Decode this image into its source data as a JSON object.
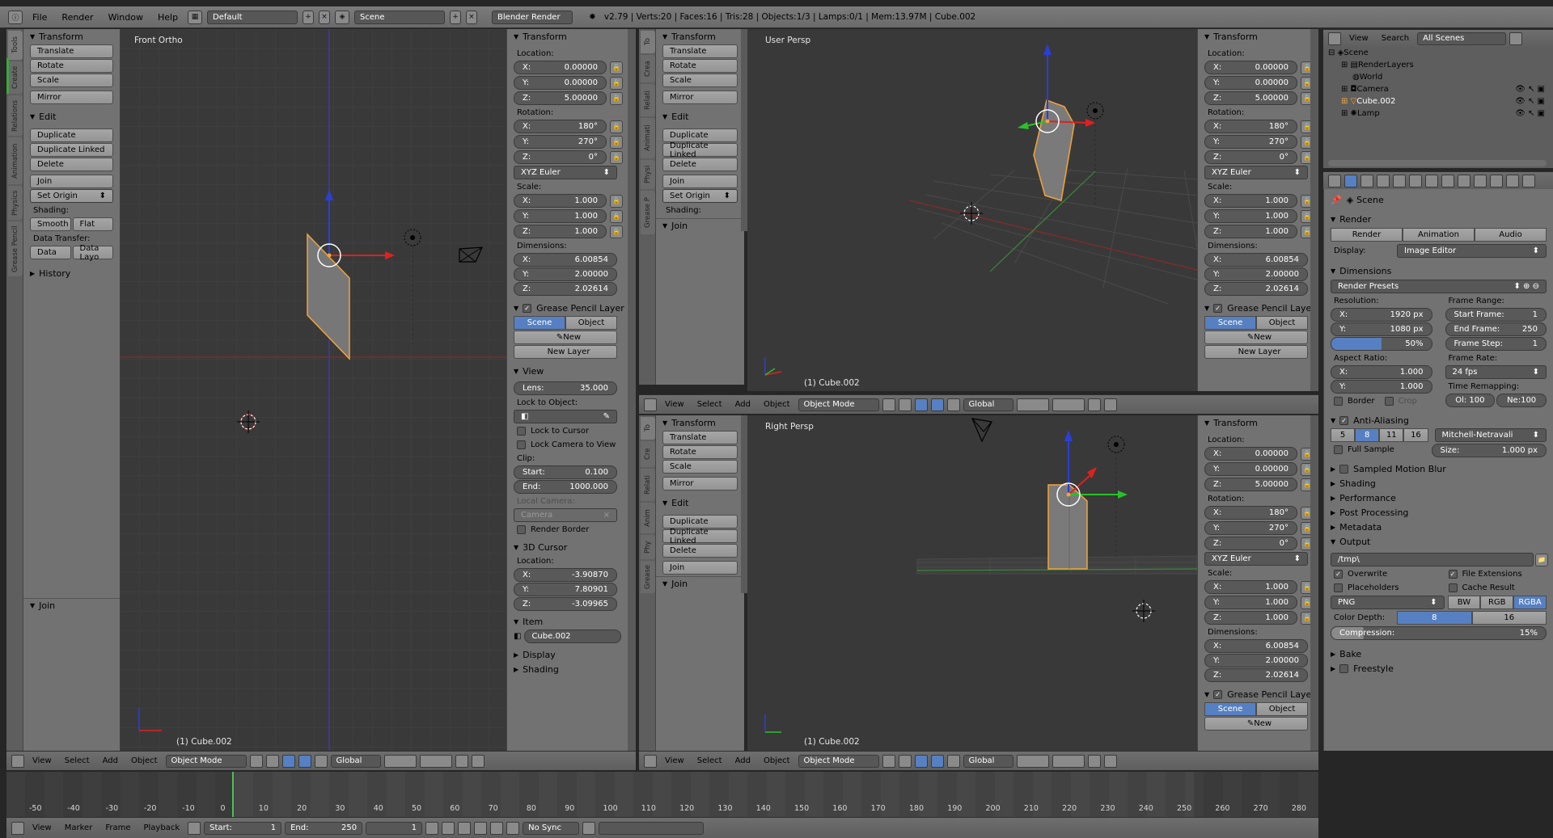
{
  "menubar": {
    "items": [
      "File",
      "Render",
      "Window",
      "Help"
    ],
    "layout": "Default",
    "scene": "Scene",
    "engine": "Blender Render",
    "stats": "v2.79 | Verts:20 | Faces:16 | Tris:28 | Objects:1/3 | Lamps:0/1 | Mem:13.97M | Cube.002"
  },
  "viewports": {
    "front": {
      "label": "Front Ortho",
      "object": "(1) Cube.002"
    },
    "user": {
      "label": "User Persp",
      "object": "(1) Cube.002"
    },
    "right": {
      "label": "Right Persp",
      "object": "(1) Cube.002"
    }
  },
  "tools": {
    "tabs": [
      "Tools",
      "Create",
      "Relations",
      "Animation",
      "Physics",
      "Grease Pencil"
    ],
    "tabs_short": [
      "To",
      "Crea",
      "Relati",
      "Animati",
      "Physi",
      "Grease P"
    ],
    "tabs_short2": [
      "To",
      "Cre",
      "Relati",
      "Anim",
      "Phy",
      "Grease"
    ],
    "transform_header": "Transform",
    "translate": "Translate",
    "rotate": "Rotate",
    "scale": "Scale",
    "mirror": "Mirror",
    "edit_header": "Edit",
    "duplicate": "Duplicate",
    "duplicate_linked": "Duplicate Linked",
    "delete": "Delete",
    "join": "Join",
    "set_origin": "Set Origin",
    "shading_label": "Shading:",
    "smooth": "Smooth",
    "flat": "Flat",
    "data_transfer_label": "Data Transfer:",
    "data": "Data",
    "data_layout": "Data Layo",
    "history": "History",
    "join_header": "Join"
  },
  "nprops": {
    "transform_header": "Transform",
    "location_label": "Location:",
    "loc": [
      "X:",
      "0.00000",
      "Y:",
      "0.00000",
      "Z:",
      "5.00000"
    ],
    "rotation_label": "Rotation:",
    "rot": [
      "X:",
      "180°",
      "Y:",
      "270°",
      "Z:",
      "0°"
    ],
    "rotation_mode": "XYZ Euler",
    "scale_label": "Scale:",
    "scl": [
      "X:",
      "1.000",
      "Y:",
      "1.000",
      "Z:",
      "1.000"
    ],
    "dimensions_label": "Dimensions:",
    "dim": [
      "X:",
      "6.00854",
      "Y:",
      "2.00000",
      "Z:",
      "2.02614"
    ],
    "grease_header": "Grease Pencil Layer",
    "scene": "Scene",
    "object": "Object",
    "new": "New",
    "new_layer": "New Layer",
    "view_header": "View",
    "lens_label": "Lens:",
    "lens": "35.000",
    "lock_object": "Lock to Object:",
    "lock_cursor": "Lock to Cursor",
    "lock_camera": "Lock Camera to View",
    "clip_label": "Clip:",
    "start_label": "Start:",
    "start": "0.100",
    "end_label": "End:",
    "end": "1000.000",
    "local_camera": "Local Camera:",
    "camera": "Camera",
    "render_border": "Render Border",
    "cursor_header": "3D Cursor",
    "cursor_location": "Location:",
    "cur": [
      "X:",
      "-3.90870",
      "Y:",
      "7.80901",
      "Z:",
      "-3.09965"
    ],
    "item_header": "Item",
    "item_name": "Cube.002",
    "display_header": "Display",
    "shading_header": "Shading"
  },
  "view3d_header": {
    "menus": [
      "View",
      "Select",
      "Add",
      "Object"
    ],
    "mode": "Object Mode",
    "orientation": "Global"
  },
  "outliner": {
    "menus": [
      "View",
      "Search"
    ],
    "filter": "All Scenes",
    "rows": [
      "Scene",
      "RenderLayers",
      "World",
      "Camera",
      "Cube.002",
      "Lamp"
    ]
  },
  "properties": {
    "breadcrumb": "Scene",
    "render_header": "Render",
    "render": "Render",
    "animation": "Animation",
    "audio": "Audio",
    "display_label": "Display:",
    "display_value": "Image Editor",
    "dimensions_header": "Dimensions",
    "presets": "Render Presets",
    "resolution_label": "Resolution:",
    "res_x_label": "X:",
    "res_x": "1920 px",
    "res_y_label": "Y:",
    "res_y": "1080 px",
    "res_pct": "50%",
    "frame_range_label": "Frame Range:",
    "start_frame_label": "Start Frame:",
    "start_frame": "1",
    "end_frame_label": "End Frame:",
    "end_frame": "250",
    "frame_step_label": "Frame Step:",
    "frame_step": "1",
    "aspect_label": "Aspect Ratio:",
    "asp_x_label": "X:",
    "asp_x": "1.000",
    "asp_y_label": "Y:",
    "asp_y": "1.000",
    "frame_rate_label": "Frame Rate:",
    "frame_rate": "24 fps",
    "time_remap_label": "Time Remapping:",
    "old": "Ol: 100",
    "new": "Ne:100",
    "border": "Border",
    "crop": "Crop",
    "aa_header": "Anti-Aliasing",
    "aa_samples": [
      "5",
      "8",
      "11",
      "16"
    ],
    "aa_filter": "Mitchell-Netravali",
    "full_sample": "Full Sample",
    "size_label": "Size:",
    "size": "1.000 px",
    "motion_blur": "Sampled Motion Blur",
    "shading": "Shading",
    "performance": "Performance",
    "post_processing": "Post Processing",
    "metadata": "Metadata",
    "output_header": "Output",
    "output_path": "/tmp\\",
    "overwrite": "Overwrite",
    "file_extensions": "File Extensions",
    "placeholders": "Placeholders",
    "cache_result": "Cache Result",
    "format": "PNG",
    "bw": "BW",
    "rgb": "RGB",
    "rgba": "RGBA",
    "color_depth_label": "Color Depth:",
    "depth_8": "8",
    "depth_16": "16",
    "compression_label": "Compression:",
    "compression": "15%",
    "bake": "Bake",
    "freestyle": "Freestyle"
  },
  "timeline": {
    "ticks": [
      "-50",
      "-40",
      "-30",
      "-20",
      "-10",
      "0",
      "10",
      "20",
      "30",
      "40",
      "50",
      "60",
      "70",
      "80",
      "90",
      "100",
      "110",
      "120",
      "130",
      "140",
      "150",
      "160",
      "170",
      "180",
      "190",
      "200",
      "210",
      "220",
      "230",
      "240",
      "250",
      "260",
      "270",
      "280"
    ],
    "bottom": [
      "View",
      "Marker",
      "Frame",
      "Playback",
      "Start:",
      "1",
      "End:",
      "250",
      "1",
      "No Sync"
    ]
  },
  "colors": {
    "accent": "#5680c2",
    "selected": "#f2a43a",
    "viewport": "#393939"
  }
}
